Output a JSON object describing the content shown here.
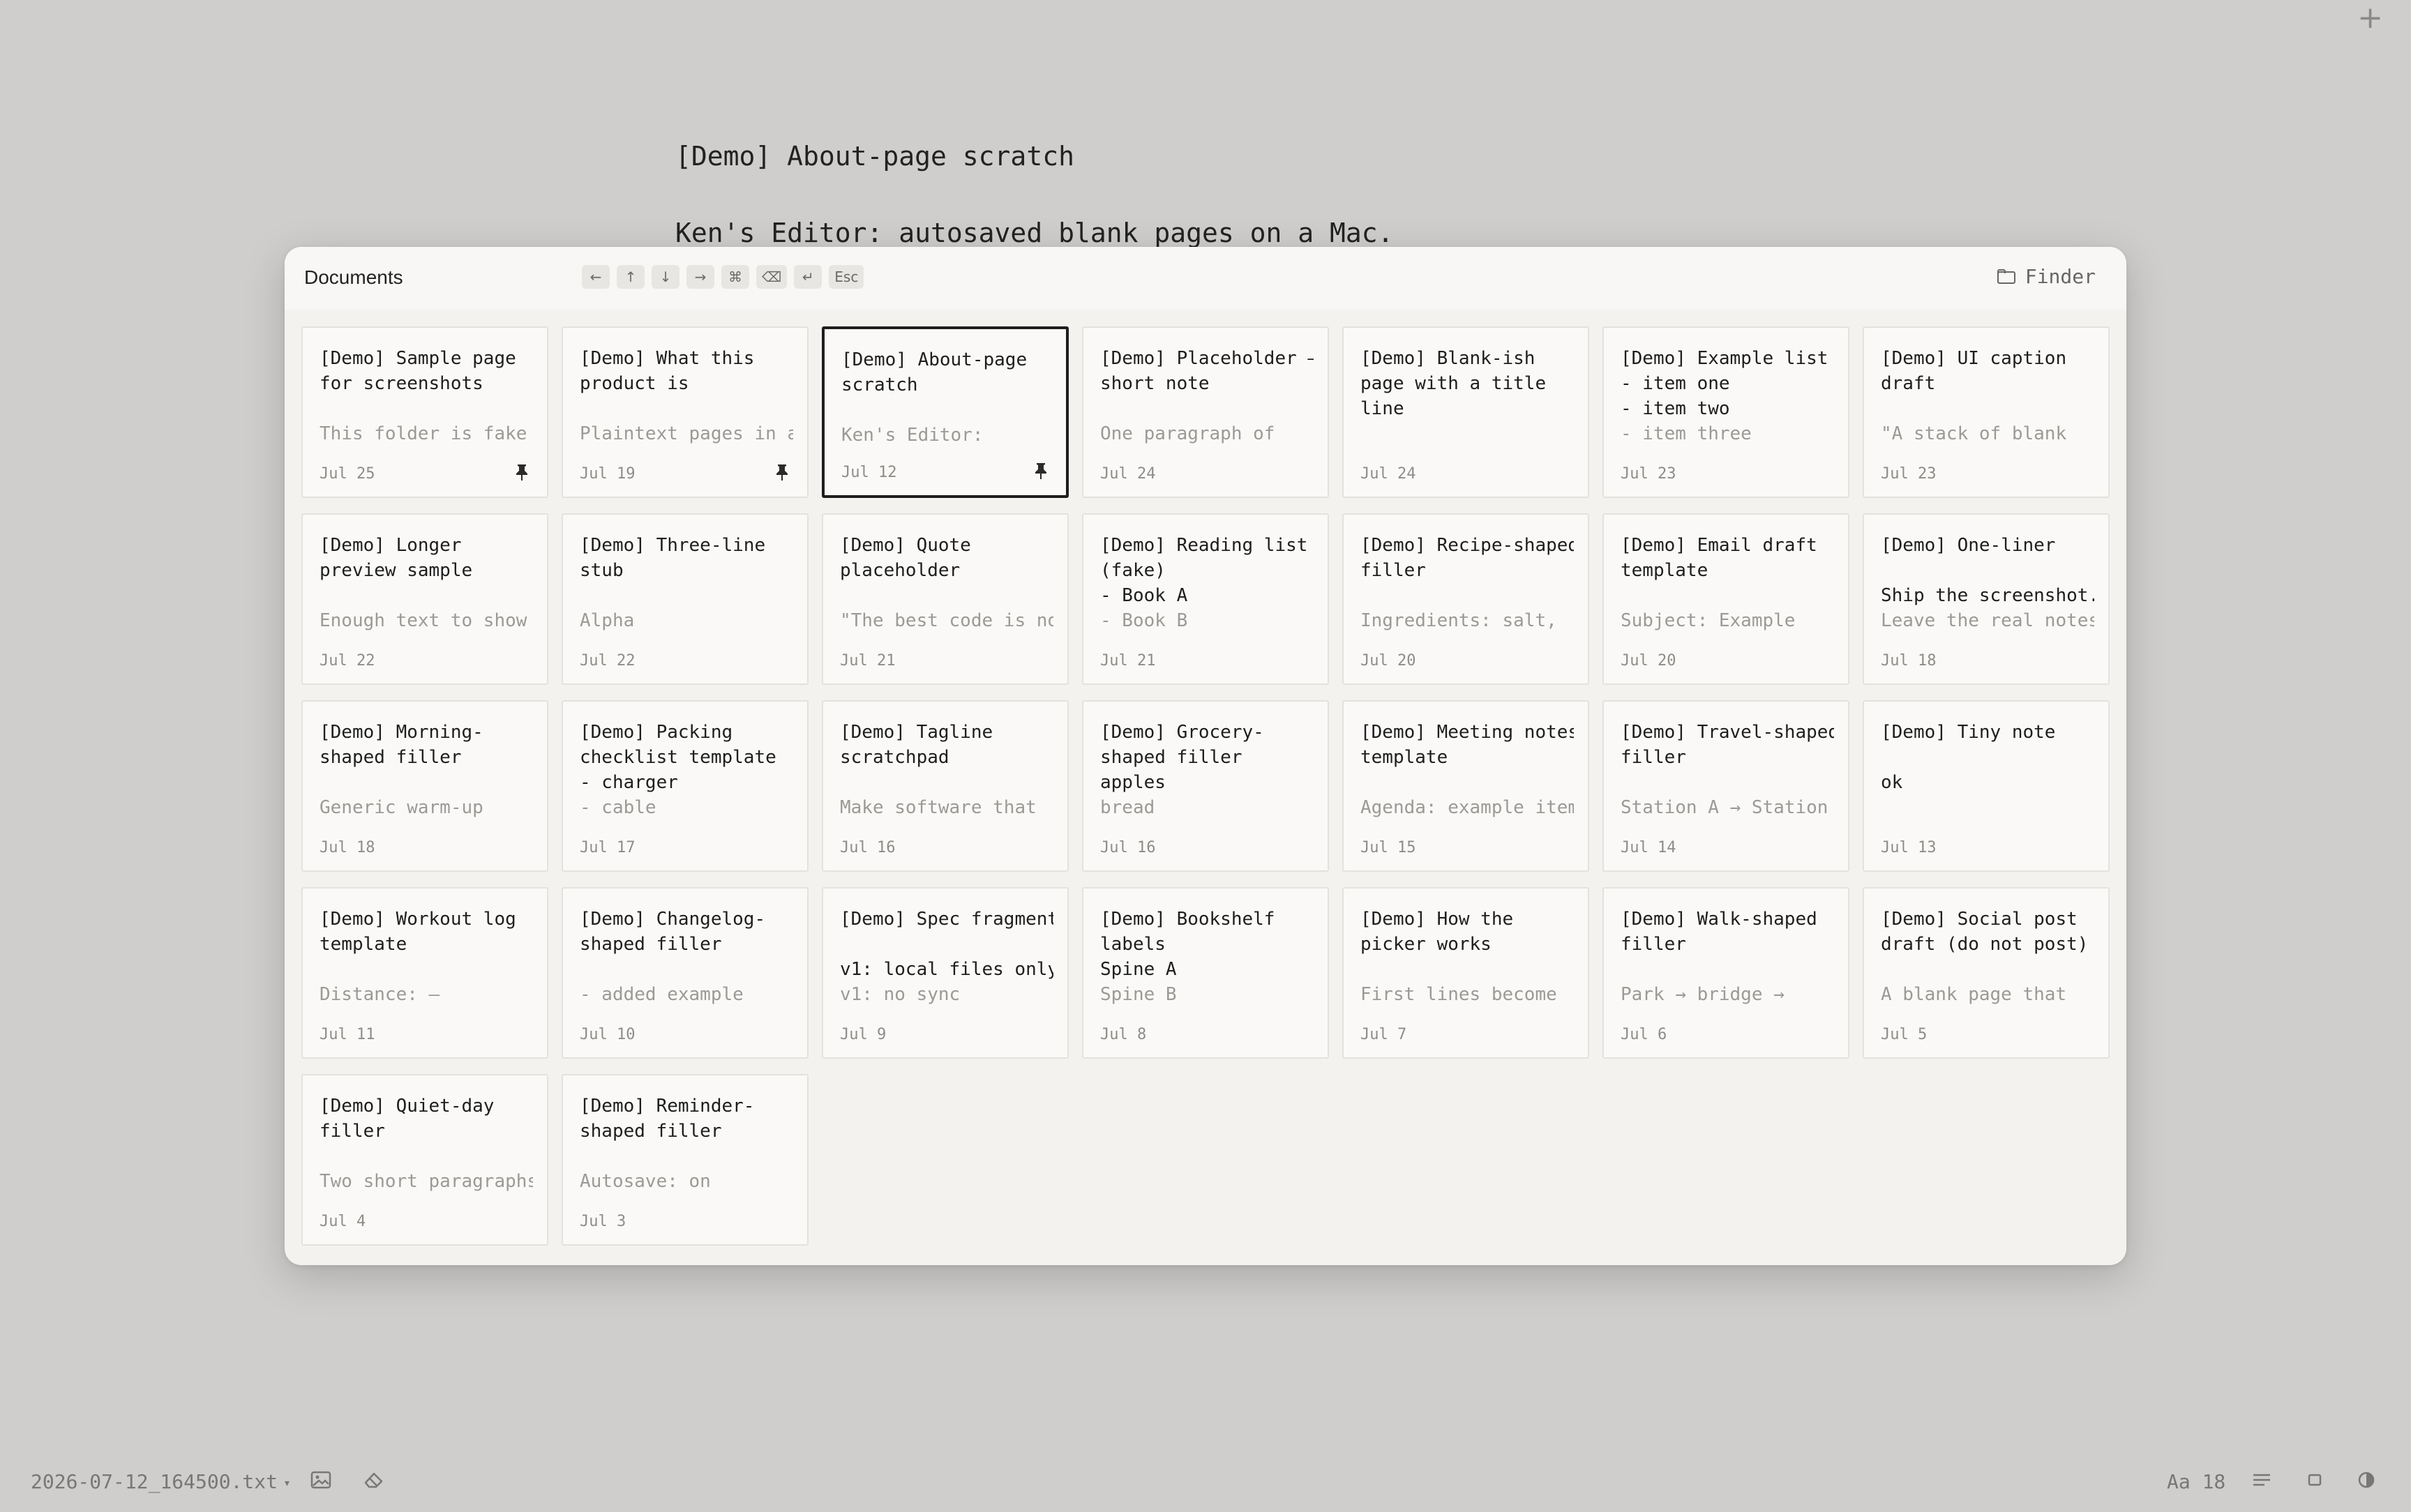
{
  "app": {
    "new_button": "+",
    "document_title": "[Demo] About-page scratch",
    "document_line": "Ken's Editor: autosaved blank pages on a Mac."
  },
  "picker": {
    "title": "Documents",
    "shortcuts": [
      "←",
      "↑",
      "↓",
      "→",
      "⌘",
      "⌫",
      "↵",
      "Esc"
    ],
    "finder_label": "Finder",
    "cards": [
      {
        "title": "[Demo] Sample page\nfor screenshots",
        "preview": "This folder is fake",
        "date": "Jul 25",
        "pinned": true,
        "selected": false
      },
      {
        "title": "[Demo] What this\nproduct is",
        "preview": "Plaintext pages in a",
        "date": "Jul 19",
        "pinned": true,
        "selected": false
      },
      {
        "title": "[Demo] About-page\nscratch",
        "preview": "Ken's Editor:",
        "date": "Jul 12",
        "pinned": true,
        "selected": true
      },
      {
        "title": "[Demo] Placeholder —\nshort note",
        "preview": "One paragraph of",
        "date": "Jul 24",
        "pinned": false,
        "selected": false
      },
      {
        "title": "[Demo] Blank-ish\npage with a title\nline",
        "preview": "",
        "date": "Jul 24",
        "pinned": false,
        "selected": false
      },
      {
        "title": "[Demo] Example list\n- item one\n- item two",
        "preview": "- item three",
        "date": "Jul 23",
        "pinned": false,
        "selected": false
      },
      {
        "title": "[Demo] UI caption\ndraft",
        "preview": "\"A stack of blank",
        "date": "Jul 23",
        "pinned": false,
        "selected": false
      },
      {
        "title": "[Demo] Longer\npreview sample",
        "preview": "Enough text to show",
        "date": "Jul 22",
        "pinned": false,
        "selected": false
      },
      {
        "title": "[Demo] Three-line\nstub",
        "preview": "Alpha",
        "date": "Jul 22",
        "pinned": false,
        "selected": false
      },
      {
        "title": "[Demo] Quote\nplaceholder",
        "preview": "\"The best code is no",
        "date": "Jul 21",
        "pinned": false,
        "selected": false
      },
      {
        "title": "[Demo] Reading list\n(fake)\n- Book A",
        "preview": "- Book B",
        "date": "Jul 21",
        "pinned": false,
        "selected": false
      },
      {
        "title": "[Demo] Recipe-shaped\nfiller",
        "preview": "Ingredients: salt,",
        "date": "Jul 20",
        "pinned": false,
        "selected": false
      },
      {
        "title": "[Demo] Email draft\ntemplate",
        "preview": "Subject: Example",
        "date": "Jul 20",
        "pinned": false,
        "selected": false
      },
      {
        "title": "[Demo] One-liner\n\nShip the screenshot.",
        "preview": "Leave the real notes",
        "date": "Jul 18",
        "pinned": false,
        "selected": false
      },
      {
        "title": "[Demo] Morning-\nshaped filler",
        "preview": "Generic warm-up",
        "date": "Jul 18",
        "pinned": false,
        "selected": false
      },
      {
        "title": "[Demo] Packing\nchecklist template\n- charger",
        "preview": "- cable",
        "date": "Jul 17",
        "pinned": false,
        "selected": false
      },
      {
        "title": "[Demo] Tagline\nscratchpad",
        "preview": "Make software that",
        "date": "Jul 16",
        "pinned": false,
        "selected": false
      },
      {
        "title": "[Demo] Grocery-\nshaped filler\napples",
        "preview": "bread",
        "date": "Jul 16",
        "pinned": false,
        "selected": false
      },
      {
        "title": "[Demo] Meeting notes\ntemplate",
        "preview": "Agenda: example item",
        "date": "Jul 15",
        "pinned": false,
        "selected": false
      },
      {
        "title": "[Demo] Travel-shaped\nfiller",
        "preview": "Station A → Station",
        "date": "Jul 14",
        "pinned": false,
        "selected": false
      },
      {
        "title": "[Demo] Tiny note\n\nok",
        "preview": "",
        "date": "Jul 13",
        "pinned": false,
        "selected": false
      },
      {
        "title": "[Demo] Workout log\ntemplate",
        "preview": "Distance: —",
        "date": "Jul 11",
        "pinned": false,
        "selected": false
      },
      {
        "title": "[Demo] Changelog-\nshaped filler",
        "preview": "- added example",
        "date": "Jul 10",
        "pinned": false,
        "selected": false
      },
      {
        "title": "[Demo] Spec fragment\n\nv1: local files only",
        "preview": "v1: no sync",
        "date": "Jul 9",
        "pinned": false,
        "selected": false
      },
      {
        "title": "[Demo] Bookshelf\nlabels\nSpine A",
        "preview": "Spine B",
        "date": "Jul 8",
        "pinned": false,
        "selected": false
      },
      {
        "title": "[Demo] How the\npicker works",
        "preview": "First lines become",
        "date": "Jul 7",
        "pinned": false,
        "selected": false
      },
      {
        "title": "[Demo] Walk-shaped\nfiller",
        "preview": "Park → bridge →",
        "date": "Jul 6",
        "pinned": false,
        "selected": false
      },
      {
        "title": "[Demo] Social post\ndraft (do not post)",
        "preview": "A blank page that",
        "date": "Jul 5",
        "pinned": false,
        "selected": false
      },
      {
        "title": "[Demo] Quiet-day\nfiller",
        "preview": "Two short paragraphs",
        "date": "Jul 4",
        "pinned": false,
        "selected": false
      },
      {
        "title": "[Demo] Reminder-\nshaped filler",
        "preview": "Autosave: on",
        "date": "Jul 3",
        "pinned": false,
        "selected": false
      }
    ]
  },
  "status_bar": {
    "filename": "2026-07-12_164500.txt",
    "font_size": "Aa 18",
    "icons": [
      "image-icon",
      "eraser-icon",
      "lines-icon",
      "square-icon",
      "contrast-icon"
    ]
  }
}
